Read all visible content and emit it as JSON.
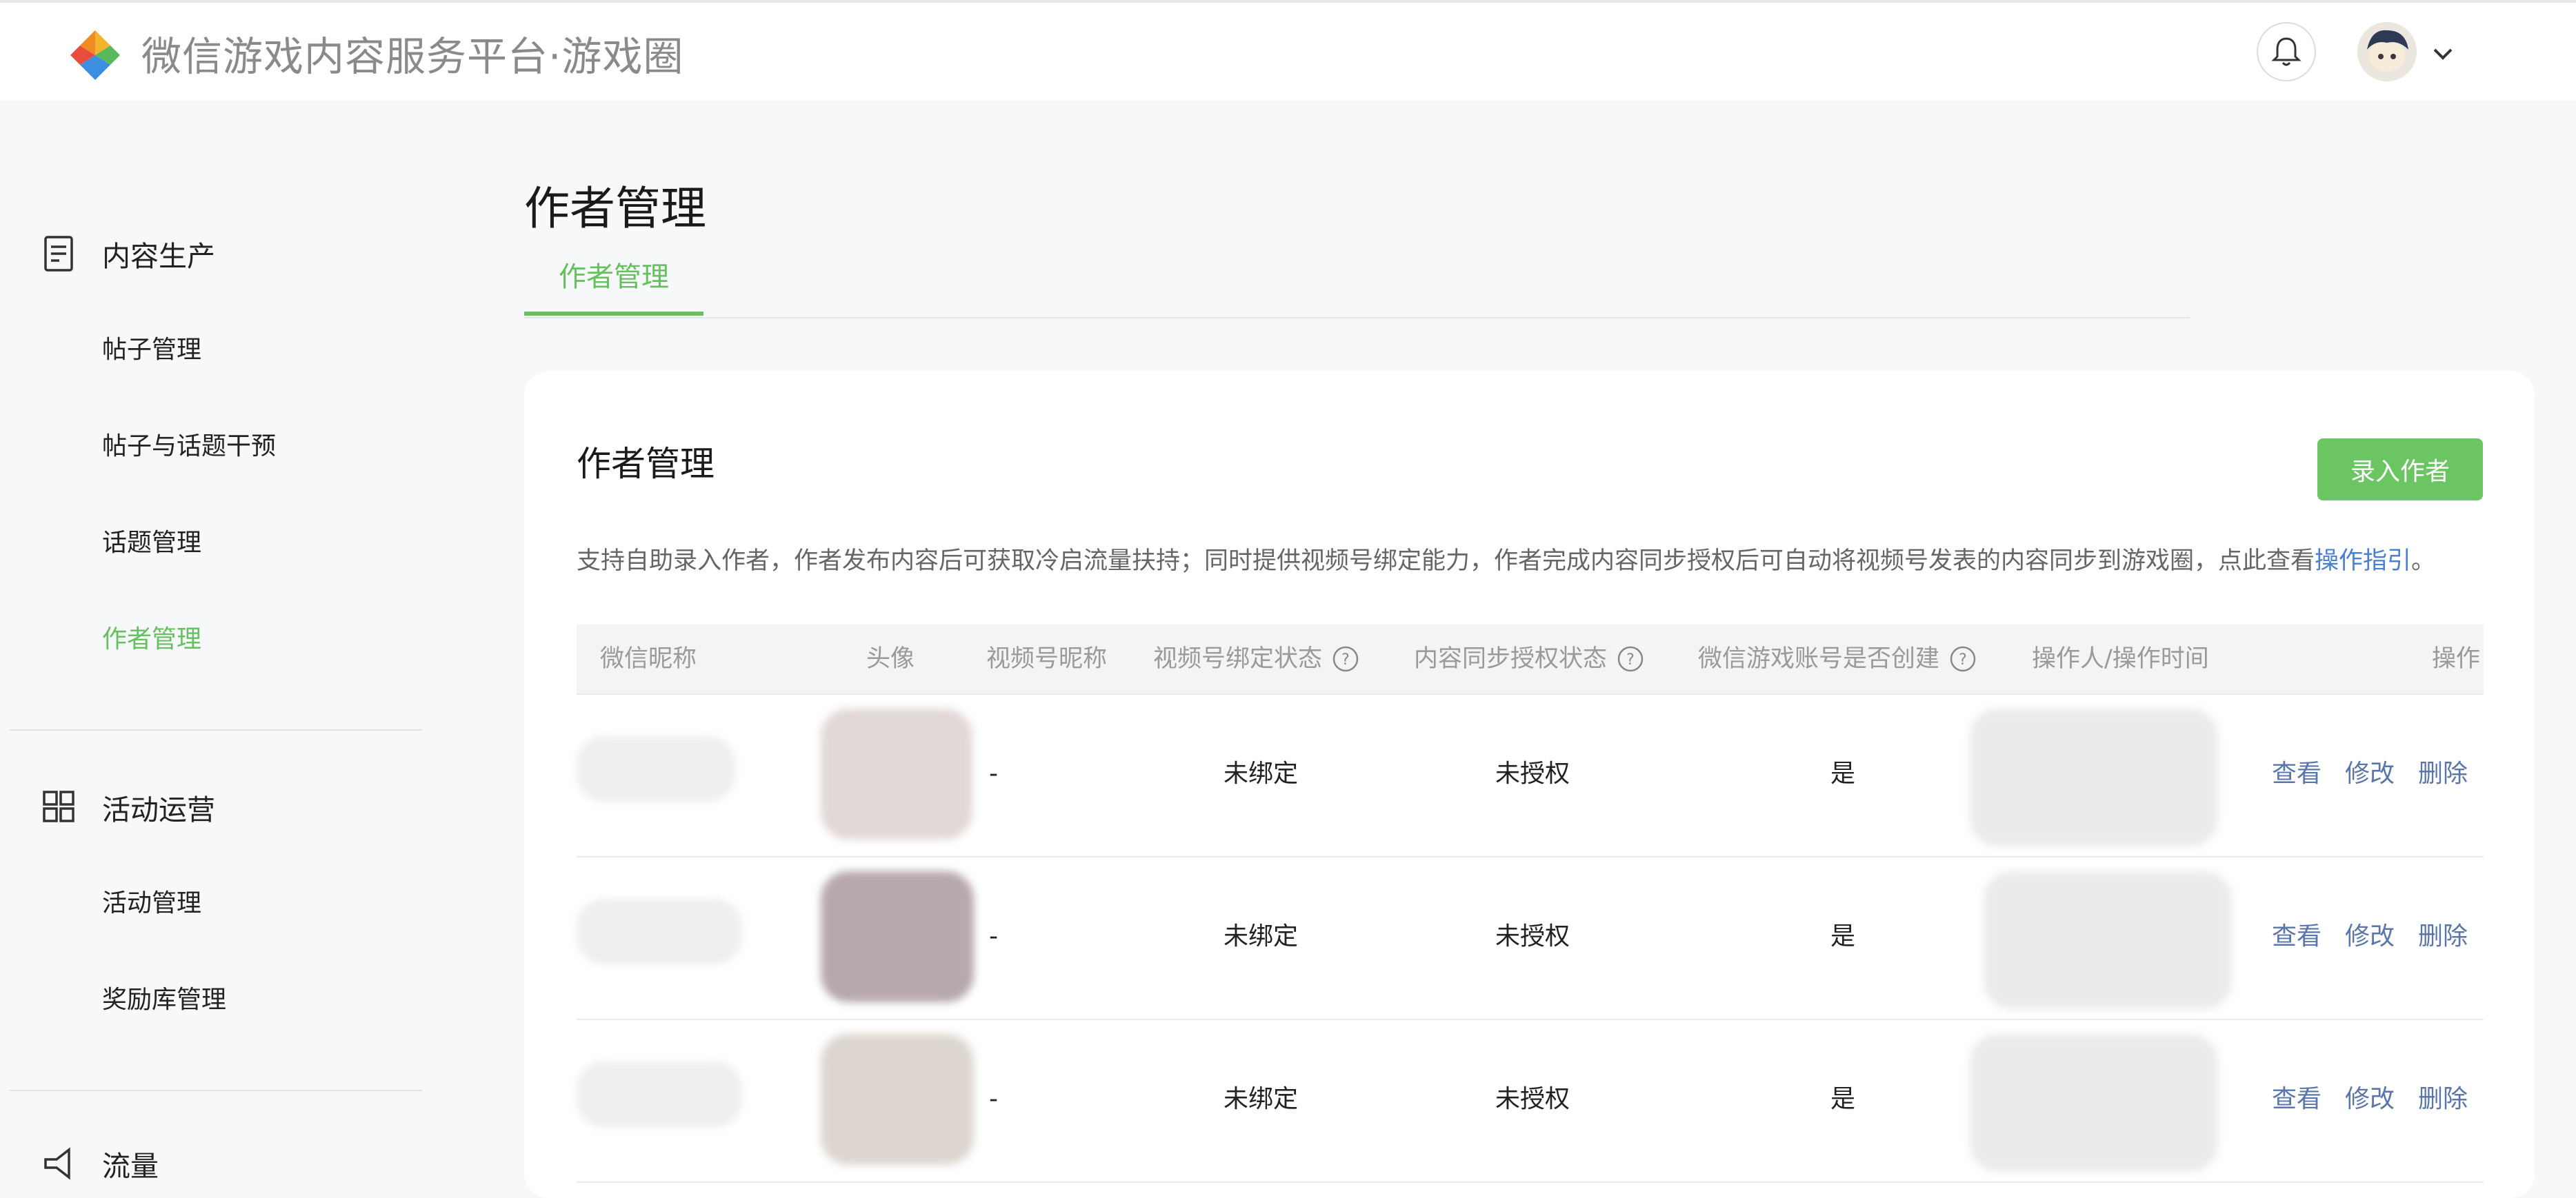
{
  "app": {
    "title": "微信游戏内容服务平台·游戏圈"
  },
  "sidebar": {
    "groups": [
      {
        "title": "内容生产",
        "icon": "document-icon",
        "items": [
          "帖子管理",
          "帖子与话题干预",
          "话题管理",
          "作者管理"
        ]
      },
      {
        "title": "活动运营",
        "icon": "grid-icon",
        "items": [
          "活动管理",
          "奖励库管理"
        ]
      },
      {
        "title": "流量",
        "icon": "megaphone-icon",
        "items": []
      }
    ],
    "active_item": "作者管理"
  },
  "page": {
    "title": "作者管理",
    "tabs": [
      {
        "label": "作者管理",
        "active": true
      }
    ]
  },
  "card": {
    "title": "作者管理",
    "add_button": "录入作者",
    "description": "支持自助录入作者，作者发布内容后可获取冷启流量扶持；同时提供视频号绑定能力，作者完成内容同步授权后可自动将视频号发表的内容同步到游戏圈，点此查看",
    "description_link": "操作指引",
    "description_end": "。"
  },
  "table": {
    "columns": [
      "微信昵称",
      "头像",
      "视频号昵称",
      "视频号绑定状态",
      "内容同步授权状态",
      "微信游戏账号是否创建",
      "操作人/操作时间",
      "操作"
    ],
    "rows": [
      {
        "video_nickname": "-",
        "bind_status": "未绑定",
        "auth_status": "未授权",
        "account_created": "是"
      },
      {
        "video_nickname": "-",
        "bind_status": "未绑定",
        "auth_status": "未授权",
        "account_created": "是"
      },
      {
        "video_nickname": "-",
        "bind_status": "未绑定",
        "auth_status": "未授权",
        "account_created": "是"
      }
    ],
    "actions": [
      "查看",
      "修改",
      "删除"
    ]
  },
  "colors": {
    "accent": "#67c05f",
    "link": "#4a7fd1",
    "action": "#5a76a8"
  }
}
